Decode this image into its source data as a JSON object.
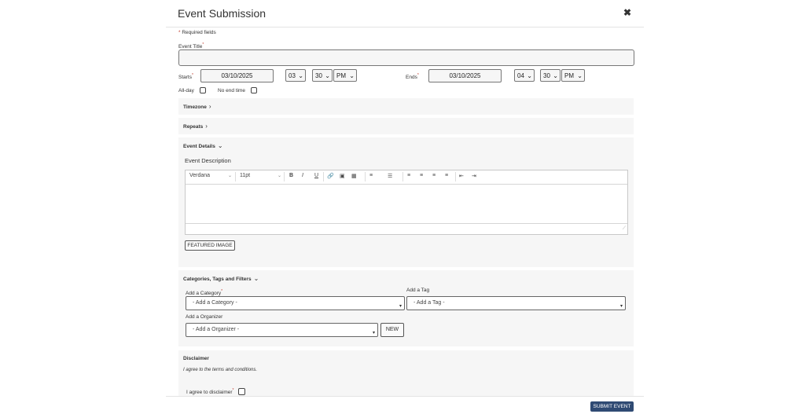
{
  "header": {
    "title": "Event Submission",
    "close": "✖"
  },
  "form": {
    "required_note": "Required fields",
    "required_star": "*",
    "event_title_label": "Event Title",
    "starts_label": "Starts",
    "start_date": "03/10/2025",
    "start_hour": "03",
    "start_minute": "30",
    "start_ampm": "PM",
    "ends_label": "Ends",
    "end_date": "03/10/2025",
    "end_hour": "04",
    "end_minute": "30",
    "end_ampm": "PM",
    "allday_label": "All-day",
    "noend_label": "No end time"
  },
  "sections": {
    "timezone": "Timezone",
    "repeats": "Repeats",
    "event_details": "Event Details",
    "event_description": "Event Description",
    "featured_image": "FEATURED IMAGE",
    "categories": "Categories, Tags and Filters",
    "add_category_label": "Add a Category",
    "add_category_placeholder": "- Add a Category -",
    "add_tag_label": "Add a Tag",
    "add_tag_placeholder": "- Add a Tag -",
    "add_organizer_label": "Add a Organizer",
    "add_organizer_placeholder": "- Add a Organizer -",
    "new_button": "NEW",
    "disclaimer": "Disclaimer",
    "disclaimer_text": "I agree to the terms and conditions.",
    "disclaimer_agree": "I agree to disclaimer"
  },
  "editor": {
    "font": "Verdana",
    "size": "11pt"
  },
  "footer": {
    "submit": "SUBMIT EVENT"
  },
  "colors": {
    "accent": "#2f4a73",
    "required": "#c0392b",
    "section_bg": "#f6f6f6"
  }
}
